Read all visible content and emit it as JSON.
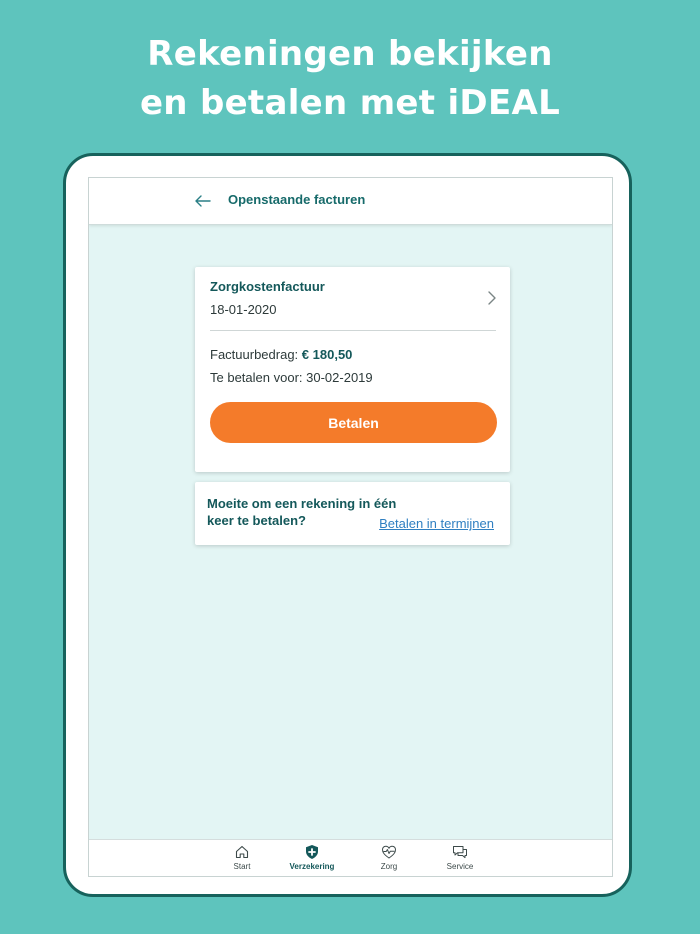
{
  "promo": {
    "line1": "Rekeningen bekijken",
    "line2": "en betalen met iDEAL"
  },
  "header": {
    "back_icon": "arrow-left-icon",
    "title": "Openstaande facturen"
  },
  "invoice": {
    "title": "Zorgkostenfactuur",
    "date": "18-01-2020",
    "amount_label": "Factuurbedrag:",
    "amount_value": "€ 180,50",
    "due_label": "Te betalen voor:",
    "due_date": "30-02-2019",
    "pay_label": "Betalen",
    "chevron_icon": "chevron-right-icon"
  },
  "installments": {
    "question": "Moeite om een rekening in één keer te betalen?",
    "link": "Betalen in termijnen"
  },
  "nav": {
    "items": [
      {
        "label": "Start",
        "icon": "home-icon"
      },
      {
        "label": "Verzekering",
        "icon": "shield-plus-icon",
        "active": true
      },
      {
        "label": "Zorg",
        "icon": "heart-pulse-icon"
      },
      {
        "label": "Service",
        "icon": "chat-bubbles-icon"
      }
    ]
  },
  "colors": {
    "background": "#5ec4bd",
    "frame": "#17625c",
    "screen": "#e3f5f4",
    "accent_text": "#14585a",
    "button": "#f47b2a",
    "link": "#2f7fc1"
  }
}
